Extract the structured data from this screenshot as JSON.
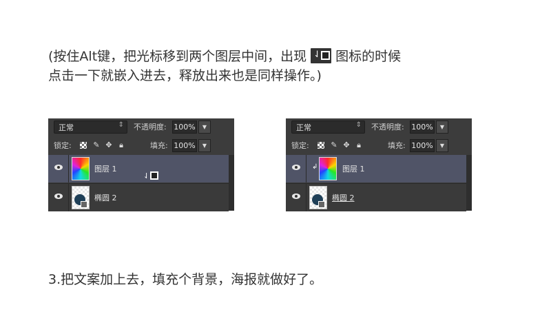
{
  "instructions": {
    "line1_before": "(按住Alt键，把光标移到两个图层中间，出现",
    "line1_icon": "clip-cursor-icon",
    "line1_after": "图标的时候",
    "line2": "点击一下就嵌入进去，释放出来也是同样操作。)"
  },
  "step3": "3.把文案加上去，填充个背景，海报就做好了。",
  "panel_left": {
    "blend_mode": "正常",
    "opacity_label": "不透明度:",
    "opacity_value": "100%",
    "lock_label": "锁定:",
    "fill_label": "填充:",
    "fill_value": "100%",
    "layers": [
      {
        "name": "图层 1",
        "selected": true
      },
      {
        "name": "椭圆 2",
        "selected": false
      }
    ]
  },
  "panel_right": {
    "blend_mode": "正常",
    "opacity_label": "不透明度:",
    "opacity_value": "100%",
    "lock_label": "锁定:",
    "fill_label": "填充:",
    "fill_value": "100%",
    "layers": [
      {
        "name": "图层 1",
        "selected": true,
        "clipped": true
      },
      {
        "name": "椭圆 2",
        "selected": false,
        "underlined": true
      }
    ]
  },
  "colors": {
    "panel_bg": "#3c3c3c",
    "selected_row": "#505467",
    "text_dark": "#333333"
  }
}
